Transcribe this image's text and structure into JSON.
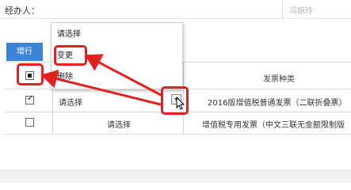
{
  "form": {
    "agent_label": "经办人：",
    "agent_value": "冯婉玲"
  },
  "toolbar": {
    "add_row_label": "增行"
  },
  "table": {
    "invoice_type_header": "发票种类",
    "rows": [
      {
        "checked": true,
        "action": "请选择",
        "invoice_type": "2016版增值税普通发票（二联折叠票）"
      },
      {
        "checked": false,
        "action": "请选择",
        "invoice_type": "增值税专用发票（中文三联无金额限制版"
      }
    ]
  },
  "dropdown": {
    "options": [
      "请选择",
      "变更",
      "删除"
    ]
  },
  "colors": {
    "accent": "#3a84d6",
    "annotation": "#e32020"
  }
}
